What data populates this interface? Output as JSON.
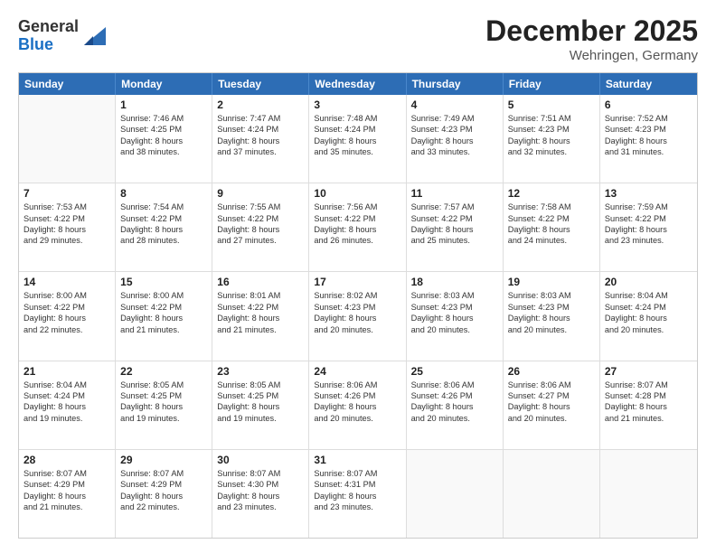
{
  "logo": {
    "general": "General",
    "blue": "Blue"
  },
  "title": "December 2025",
  "subtitle": "Wehringen, Germany",
  "header_days": [
    "Sunday",
    "Monday",
    "Tuesday",
    "Wednesday",
    "Thursday",
    "Friday",
    "Saturday"
  ],
  "weeks": [
    [
      {
        "day": "",
        "lines": []
      },
      {
        "day": "1",
        "lines": [
          "Sunrise: 7:46 AM",
          "Sunset: 4:25 PM",
          "Daylight: 8 hours",
          "and 38 minutes."
        ]
      },
      {
        "day": "2",
        "lines": [
          "Sunrise: 7:47 AM",
          "Sunset: 4:24 PM",
          "Daylight: 8 hours",
          "and 37 minutes."
        ]
      },
      {
        "day": "3",
        "lines": [
          "Sunrise: 7:48 AM",
          "Sunset: 4:24 PM",
          "Daylight: 8 hours",
          "and 35 minutes."
        ]
      },
      {
        "day": "4",
        "lines": [
          "Sunrise: 7:49 AM",
          "Sunset: 4:23 PM",
          "Daylight: 8 hours",
          "and 33 minutes."
        ]
      },
      {
        "day": "5",
        "lines": [
          "Sunrise: 7:51 AM",
          "Sunset: 4:23 PM",
          "Daylight: 8 hours",
          "and 32 minutes."
        ]
      },
      {
        "day": "6",
        "lines": [
          "Sunrise: 7:52 AM",
          "Sunset: 4:23 PM",
          "Daylight: 8 hours",
          "and 31 minutes."
        ]
      }
    ],
    [
      {
        "day": "7",
        "lines": [
          "Sunrise: 7:53 AM",
          "Sunset: 4:22 PM",
          "Daylight: 8 hours",
          "and 29 minutes."
        ]
      },
      {
        "day": "8",
        "lines": [
          "Sunrise: 7:54 AM",
          "Sunset: 4:22 PM",
          "Daylight: 8 hours",
          "and 28 minutes."
        ]
      },
      {
        "day": "9",
        "lines": [
          "Sunrise: 7:55 AM",
          "Sunset: 4:22 PM",
          "Daylight: 8 hours",
          "and 27 minutes."
        ]
      },
      {
        "day": "10",
        "lines": [
          "Sunrise: 7:56 AM",
          "Sunset: 4:22 PM",
          "Daylight: 8 hours",
          "and 26 minutes."
        ]
      },
      {
        "day": "11",
        "lines": [
          "Sunrise: 7:57 AM",
          "Sunset: 4:22 PM",
          "Daylight: 8 hours",
          "and 25 minutes."
        ]
      },
      {
        "day": "12",
        "lines": [
          "Sunrise: 7:58 AM",
          "Sunset: 4:22 PM",
          "Daylight: 8 hours",
          "and 24 minutes."
        ]
      },
      {
        "day": "13",
        "lines": [
          "Sunrise: 7:59 AM",
          "Sunset: 4:22 PM",
          "Daylight: 8 hours",
          "and 23 minutes."
        ]
      }
    ],
    [
      {
        "day": "14",
        "lines": [
          "Sunrise: 8:00 AM",
          "Sunset: 4:22 PM",
          "Daylight: 8 hours",
          "and 22 minutes."
        ]
      },
      {
        "day": "15",
        "lines": [
          "Sunrise: 8:00 AM",
          "Sunset: 4:22 PM",
          "Daylight: 8 hours",
          "and 21 minutes."
        ]
      },
      {
        "day": "16",
        "lines": [
          "Sunrise: 8:01 AM",
          "Sunset: 4:22 PM",
          "Daylight: 8 hours",
          "and 21 minutes."
        ]
      },
      {
        "day": "17",
        "lines": [
          "Sunrise: 8:02 AM",
          "Sunset: 4:23 PM",
          "Daylight: 8 hours",
          "and 20 minutes."
        ]
      },
      {
        "day": "18",
        "lines": [
          "Sunrise: 8:03 AM",
          "Sunset: 4:23 PM",
          "Daylight: 8 hours",
          "and 20 minutes."
        ]
      },
      {
        "day": "19",
        "lines": [
          "Sunrise: 8:03 AM",
          "Sunset: 4:23 PM",
          "Daylight: 8 hours",
          "and 20 minutes."
        ]
      },
      {
        "day": "20",
        "lines": [
          "Sunrise: 8:04 AM",
          "Sunset: 4:24 PM",
          "Daylight: 8 hours",
          "and 20 minutes."
        ]
      }
    ],
    [
      {
        "day": "21",
        "lines": [
          "Sunrise: 8:04 AM",
          "Sunset: 4:24 PM",
          "Daylight: 8 hours",
          "and 19 minutes."
        ]
      },
      {
        "day": "22",
        "lines": [
          "Sunrise: 8:05 AM",
          "Sunset: 4:25 PM",
          "Daylight: 8 hours",
          "and 19 minutes."
        ]
      },
      {
        "day": "23",
        "lines": [
          "Sunrise: 8:05 AM",
          "Sunset: 4:25 PM",
          "Daylight: 8 hours",
          "and 19 minutes."
        ]
      },
      {
        "day": "24",
        "lines": [
          "Sunrise: 8:06 AM",
          "Sunset: 4:26 PM",
          "Daylight: 8 hours",
          "and 20 minutes."
        ]
      },
      {
        "day": "25",
        "lines": [
          "Sunrise: 8:06 AM",
          "Sunset: 4:26 PM",
          "Daylight: 8 hours",
          "and 20 minutes."
        ]
      },
      {
        "day": "26",
        "lines": [
          "Sunrise: 8:06 AM",
          "Sunset: 4:27 PM",
          "Daylight: 8 hours",
          "and 20 minutes."
        ]
      },
      {
        "day": "27",
        "lines": [
          "Sunrise: 8:07 AM",
          "Sunset: 4:28 PM",
          "Daylight: 8 hours",
          "and 21 minutes."
        ]
      }
    ],
    [
      {
        "day": "28",
        "lines": [
          "Sunrise: 8:07 AM",
          "Sunset: 4:29 PM",
          "Daylight: 8 hours",
          "and 21 minutes."
        ]
      },
      {
        "day": "29",
        "lines": [
          "Sunrise: 8:07 AM",
          "Sunset: 4:29 PM",
          "Daylight: 8 hours",
          "and 22 minutes."
        ]
      },
      {
        "day": "30",
        "lines": [
          "Sunrise: 8:07 AM",
          "Sunset: 4:30 PM",
          "Daylight: 8 hours",
          "and 23 minutes."
        ]
      },
      {
        "day": "31",
        "lines": [
          "Sunrise: 8:07 AM",
          "Sunset: 4:31 PM",
          "Daylight: 8 hours",
          "and 23 minutes."
        ]
      },
      {
        "day": "",
        "lines": []
      },
      {
        "day": "",
        "lines": []
      },
      {
        "day": "",
        "lines": []
      }
    ]
  ]
}
